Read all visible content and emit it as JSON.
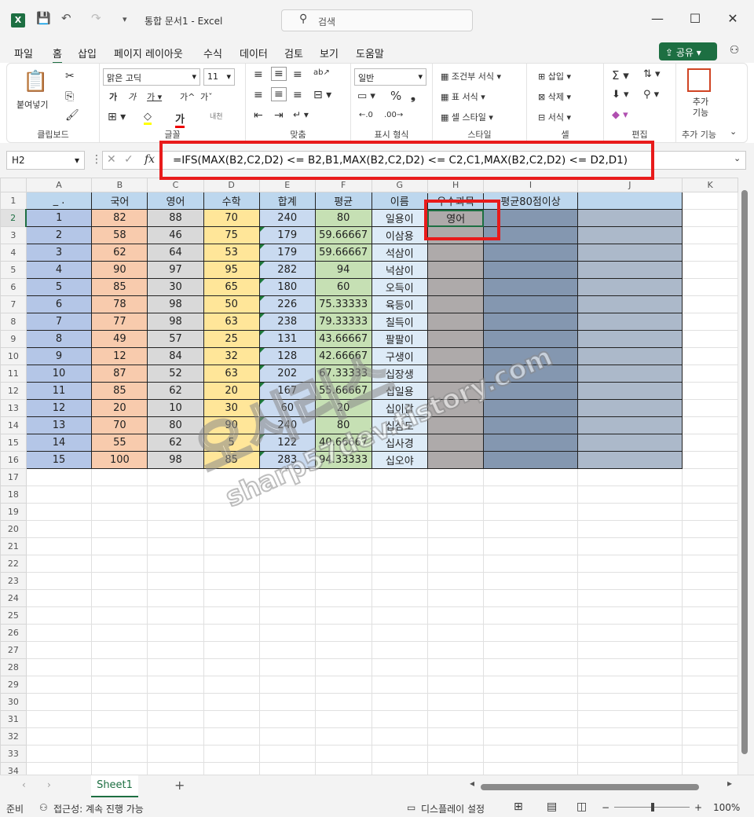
{
  "app": {
    "title": "통합 문서1 - Excel",
    "search_placeholder": "검색",
    "logo": "X"
  },
  "menu": [
    "파일",
    "홈",
    "삽입",
    "페이지 레이아웃",
    "수식",
    "데이터",
    "검토",
    "보기",
    "도움말"
  ],
  "share_label": "공유",
  "ribbon": {
    "clipboard": {
      "paste": "붙여넣기",
      "label": "클립보드"
    },
    "font": {
      "name": "맑은 고딕",
      "size": "11",
      "label": "글꼴"
    },
    "align": {
      "label": "맞춤"
    },
    "number": {
      "format": "일반",
      "label": "표시 형식"
    },
    "style": {
      "cond": "조건부 서식",
      "table": "표 서식",
      "cell": "셀 스타일",
      "label": "스타일"
    },
    "cells": {
      "insert": "삽입",
      "delete": "삭제",
      "format": "서식",
      "label": "셀"
    },
    "edit": {
      "label": "편집"
    },
    "addin": {
      "btn": "추가 기능",
      "label": "추가 기능"
    }
  },
  "formula_bar": {
    "name_box": "H2",
    "fx": "fx",
    "formula": "=IFS(MAX(B2,C2,D2) <= B2,B1,MAX(B2,C2,D2) <= C2,C1,MAX(B2,C2,D2) <= D2,D1)"
  },
  "columns": [
    "A",
    "B",
    "C",
    "D",
    "E",
    "F",
    "G",
    "H",
    "I",
    "J",
    "K"
  ],
  "header_row": [
    "_ .",
    "국어",
    "영어",
    "수학",
    "합계",
    "평균",
    "이름",
    "우수과목",
    "평균80점이상",
    ""
  ],
  "rows": [
    [
      "1",
      "82",
      "88",
      "70",
      "240",
      "80",
      "일용이",
      "영어",
      "",
      ""
    ],
    [
      "2",
      "58",
      "46",
      "75",
      "179",
      "59.66667",
      "이삼용",
      "",
      "",
      ""
    ],
    [
      "3",
      "62",
      "64",
      "53",
      "179",
      "59.66667",
      "석삼이",
      "",
      "",
      ""
    ],
    [
      "4",
      "90",
      "97",
      "95",
      "282",
      "94",
      "넉삼이",
      "",
      "",
      ""
    ],
    [
      "5",
      "85",
      "30",
      "65",
      "180",
      "60",
      "오득이",
      "",
      "",
      ""
    ],
    [
      "6",
      "78",
      "98",
      "50",
      "226",
      "75.33333",
      "육등이",
      "",
      "",
      ""
    ],
    [
      "7",
      "77",
      "98",
      "63",
      "238",
      "79.33333",
      "칠득이",
      "",
      "",
      ""
    ],
    [
      "8",
      "49",
      "57",
      "25",
      "131",
      "43.66667",
      "팔팔이",
      "",
      "",
      ""
    ],
    [
      "9",
      "12",
      "84",
      "32",
      "128",
      "42.66667",
      "구생이",
      "",
      "",
      ""
    ],
    [
      "10",
      "87",
      "52",
      "63",
      "202",
      "67.33333",
      "십장생",
      "",
      "",
      ""
    ],
    [
      "11",
      "85",
      "62",
      "20",
      "167",
      "55.66667",
      "십일용",
      "",
      "",
      ""
    ],
    [
      "12",
      "20",
      "10",
      "30",
      "60",
      "20",
      "십이갑",
      "",
      "",
      ""
    ],
    [
      "13",
      "70",
      "80",
      "90",
      "240",
      "80",
      "십삼도",
      "",
      "",
      ""
    ],
    [
      "14",
      "55",
      "62",
      "5",
      "122",
      "40.66667",
      "십사경",
      "",
      "",
      ""
    ],
    [
      "15",
      "100",
      "98",
      "85",
      "283",
      "94.33333",
      "십오야",
      "",
      "",
      ""
    ]
  ],
  "empty_rows": [
    "17",
    "18",
    "19",
    "20",
    "21",
    "22",
    "23",
    "24",
    "25",
    "26",
    "27",
    "28",
    "29",
    "30",
    "31",
    "32",
    "33",
    "34"
  ],
  "sheet_tab": "Sheet1",
  "status": {
    "ready": "준비",
    "accessibility": "접근성: 계속 진행 가능",
    "display": "디스플레이 설정",
    "zoom": "100%"
  },
  "watermark": {
    "line1": "오시리스",
    "line2": "sharp57dev.tistory.com"
  }
}
